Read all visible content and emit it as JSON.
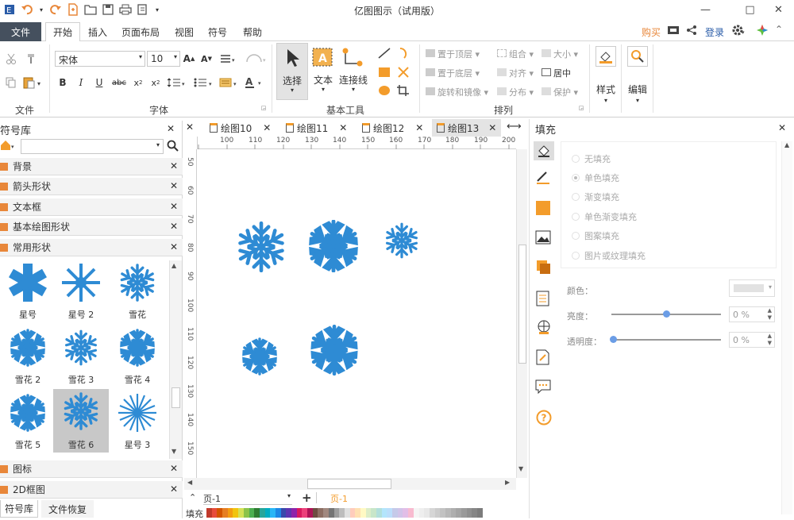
{
  "app": {
    "title": "亿图图示（试用版）"
  },
  "window_controls": {
    "minimize": "—",
    "maximize": "□",
    "close": "✕"
  },
  "menu": {
    "file": "文件",
    "tabs": [
      "开始",
      "插入",
      "页面布局",
      "视图",
      "符号",
      "帮助"
    ],
    "right": {
      "buy": "购买",
      "login": "登录"
    }
  },
  "ribbon": {
    "groups": {
      "file": "文件",
      "font": "字体",
      "basic_tools": "基本工具",
      "arrange": "排列"
    },
    "font_name": "宋体",
    "font_size": "10",
    "tools": {
      "select": "选择",
      "text": "文本",
      "connector": "连接线"
    },
    "arrange": {
      "bring_top": "置于顶层",
      "send_bottom": "置于底层",
      "rotate_mirror": "旋转和镜像",
      "group": "组合",
      "align": "对齐",
      "distribute": "分布",
      "size": "大小",
      "center": "居中",
      "protect": "保护"
    },
    "style": "样式",
    "edit": "编辑"
  },
  "library": {
    "title": "符号库",
    "categories": [
      "背景",
      "箭头形状",
      "文本框",
      "基本绘图形状",
      "常用形状"
    ],
    "shapes": [
      "星号",
      "星号 2",
      "雪花",
      "雪花 2",
      "雪花 3",
      "雪花 4",
      "雪花 5",
      "雪花 6",
      "星号 3"
    ],
    "categories_bottom": [
      "图标",
      "2D框图"
    ],
    "bottom_tabs": [
      "符号库",
      "文件恢复"
    ]
  },
  "doc_tabs": [
    "绘图10",
    "绘图11",
    "绘图12",
    "绘图13"
  ],
  "ruler_h": [
    "100",
    "110",
    "120",
    "130",
    "140",
    "150",
    "160",
    "170",
    "180",
    "190",
    "200"
  ],
  "ruler_v": [
    "50",
    "60",
    "70",
    "80",
    "90",
    "100",
    "110",
    "120",
    "130",
    "140",
    "150"
  ],
  "page_bar": {
    "page": "页-1",
    "page_active": "页-1"
  },
  "palette_label": "填充",
  "colors": {
    "accent": "#2e8bd4",
    "menu_dark": "#45505e",
    "orange": "#f39c2b"
  },
  "fill_panel": {
    "title": "填充",
    "options": [
      "无填充",
      "单色填充",
      "渐变填充",
      "单色渐变填充",
      "图案填充",
      "图片或纹理填充"
    ],
    "color_label": "颜色：",
    "brightness_label": "亮度：",
    "brightness_value": "0 %",
    "transparency_label": "透明度：",
    "transparency_value": "0 %"
  }
}
